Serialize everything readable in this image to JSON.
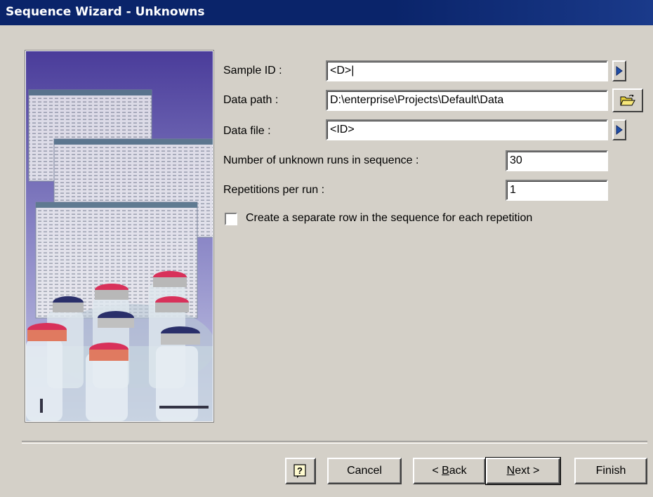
{
  "window": {
    "title": "Sequence Wizard - Unknowns"
  },
  "form": {
    "sample_id_label": "Sample ID :",
    "sample_id_value": "<D>|",
    "data_path_label": "Data path :",
    "data_path_value": "D:\\enterprise\\Projects\\Default\\Data",
    "data_file_label": "Data file :",
    "data_file_value": "<ID>",
    "num_runs_label": "Number of unknown runs in sequence :",
    "num_runs_value": "30",
    "reps_label": "Repetitions per run :",
    "reps_value": "1",
    "separate_row_label": "Create a separate row in the sequence for each repetition",
    "separate_row_checked": false
  },
  "buttons": {
    "help_label": "?",
    "cancel_label": "Cancel",
    "back_prefix": "< ",
    "back_mnemonic": "B",
    "back_rest": "ack",
    "next_mnemonic": "N",
    "next_rest": "ext >",
    "finish_label": "Finish"
  },
  "icons": {
    "sample_id_menu": "right-arrow-icon",
    "data_path_browse": "open-folder-icon",
    "data_file_menu": "right-arrow-icon",
    "help": "help-icon"
  }
}
